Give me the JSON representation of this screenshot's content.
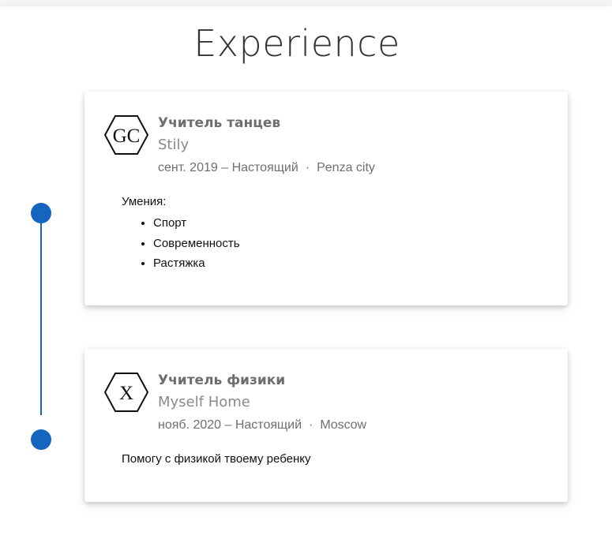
{
  "section": {
    "title": "Experience"
  },
  "timeline": {
    "accent_color": "#1565c0"
  },
  "experiences": [
    {
      "logo_text": "GC",
      "logo_icon": "hexagon-logo-icon",
      "title": "Учитель танцев",
      "company": "Stily",
      "dates": "сент. 2019 – Настоящий",
      "separator": "·",
      "location": "Penza city",
      "skills_label": "Умения:",
      "skills": [
        "Спорт",
        "Современность",
        "Растяжка"
      ]
    },
    {
      "logo_text": "X",
      "logo_icon": "hexagon-logo-icon",
      "title": "Учитель физики",
      "company": "Myself Home",
      "dates": "нояб. 2020 – Настоящий",
      "separator": "·",
      "location": "Moscow",
      "description": "Помогу с физикой твоему ребенку"
    }
  ]
}
